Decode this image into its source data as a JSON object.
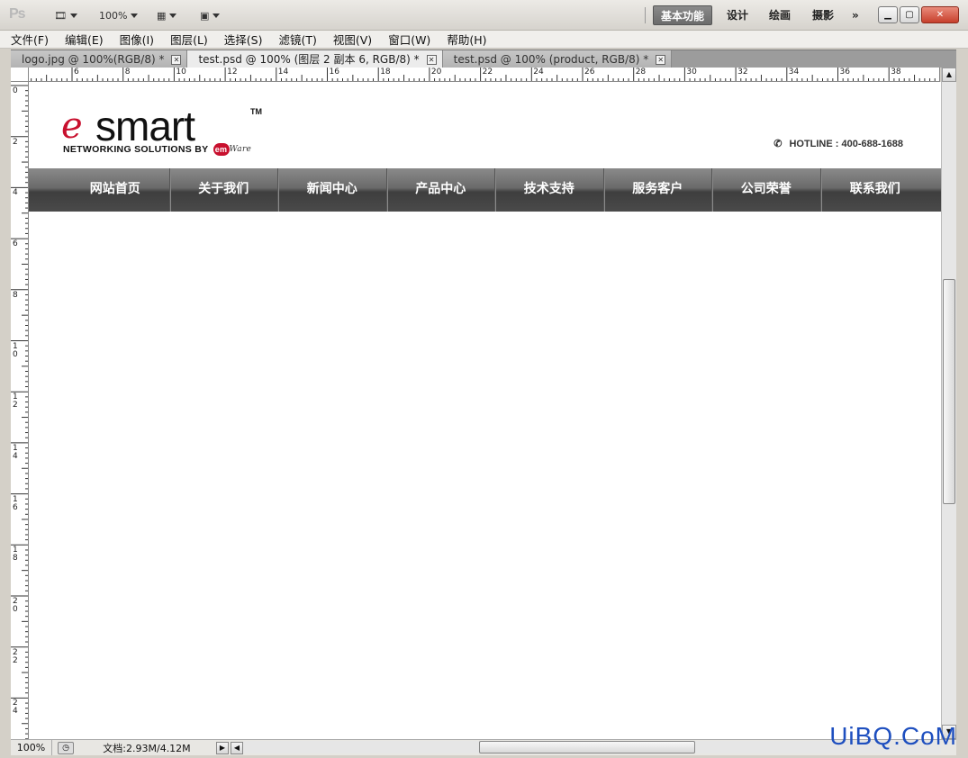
{
  "app": {
    "logo": "Ps",
    "zoom": "100%",
    "workspaces": [
      "基本功能",
      "设计",
      "绘画",
      "摄影"
    ],
    "more": "»"
  },
  "menu": [
    "文件(F)",
    "编辑(E)",
    "图像(I)",
    "图层(L)",
    "选择(S)",
    "滤镜(T)",
    "视图(V)",
    "窗口(W)",
    "帮助(H)"
  ],
  "tabs": [
    {
      "label": "logo.jpg @ 100%(RGB/8) *"
    },
    {
      "label": "test.psd @ 100% (图层 2 副本 6, RGB/8) *"
    },
    {
      "label": "test.psd @ 100% (product, RGB/8) *"
    }
  ],
  "ruler_h": [
    "6",
    "8",
    "10",
    "12",
    "14",
    "16",
    "18",
    "20",
    "22",
    "24",
    "26",
    "28",
    "30",
    "32",
    "34",
    "36",
    "38"
  ],
  "ruler_v": [
    "0",
    "2",
    "4",
    "6",
    "8",
    "10",
    "12",
    "14",
    "16",
    "18",
    "20",
    "22",
    "24"
  ],
  "site": {
    "logo_e": "e",
    "logo_smart": "smart",
    "logo_tm": "TM",
    "logo_tagline": "NETWORKING SOLUTIONS BY",
    "logo_em": "em",
    "logo_ware": "Ware",
    "hotline": "HOTLINE : 400-688-1688",
    "nav": [
      "网站首页",
      "关于我们",
      "新闻中心",
      "产品中心",
      "技术支持",
      "服务客户",
      "公司荣誉",
      "联系我们"
    ]
  },
  "status": {
    "zoom": "100%",
    "doc": "文档:2.93M/4.12M"
  },
  "watermark": "UiBQ.CoM"
}
